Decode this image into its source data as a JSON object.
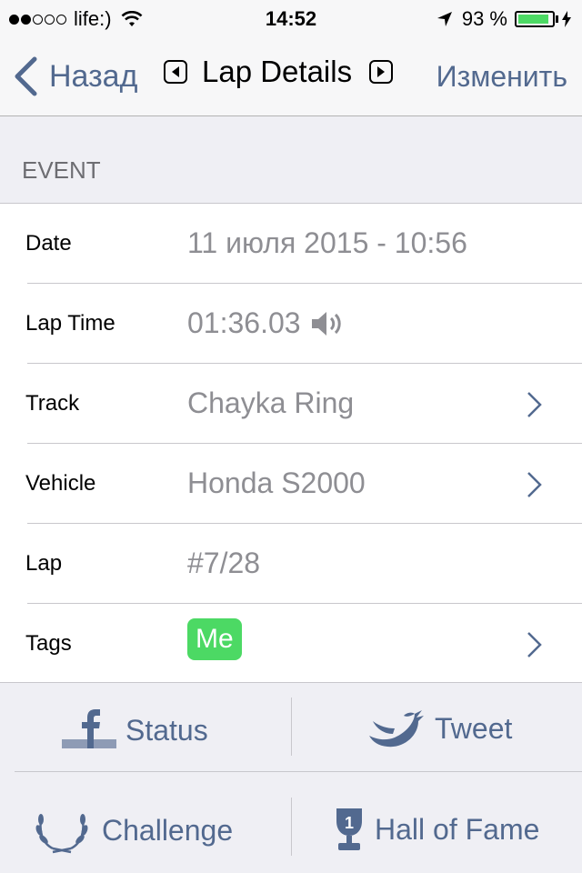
{
  "status_bar": {
    "signal_dots": [
      true,
      true,
      false,
      false,
      false
    ],
    "carrier": "life:)",
    "time": "14:52",
    "battery_percent_text": "93 %",
    "battery_level": 0.93
  },
  "nav": {
    "back_label": "Назад",
    "title": "Lap Details",
    "edit_label": "Изменить"
  },
  "section": {
    "header": "EVENT"
  },
  "rows": [
    {
      "label": "Date",
      "value": "11 июля 2015 - 10:56",
      "chevron": false
    },
    {
      "label": "Lap Time",
      "value": "01:36.03",
      "chevron": false,
      "icon": "speaker-icon"
    },
    {
      "label": "Track",
      "value": "Chayka Ring",
      "chevron": true
    },
    {
      "label": "Vehicle",
      "value": "Honda S2000",
      "chevron": true
    },
    {
      "label": "Lap",
      "value": "#7/28",
      "chevron": false
    },
    {
      "label": "Tags",
      "tag": "Me",
      "chevron": true
    }
  ],
  "actions": {
    "status_label": "Status",
    "tweet_label": "Tweet",
    "challenge_label": "Challenge",
    "hall_of_fame_label": "Hall of Fame"
  },
  "colors": {
    "accent": "#52698f",
    "tag_green": "#4cd964",
    "value_gray": "#8e8e93"
  }
}
